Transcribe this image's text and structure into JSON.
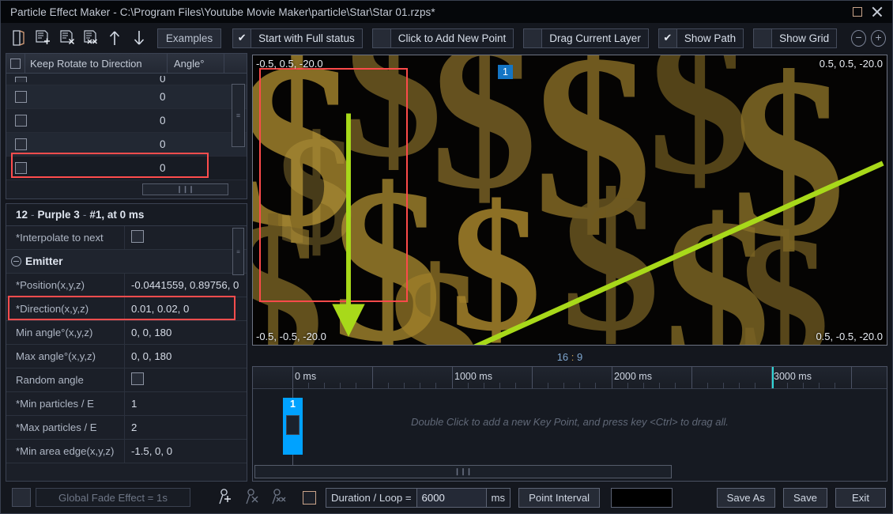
{
  "window": {
    "title": "Particle Effect Maker - C:\\Program Files\\Youtube Movie Maker\\particle\\Star\\Star 01.rzps*",
    "maximize_icon": "maximize-icon",
    "close_icon": "close-icon"
  },
  "toolbar": {
    "icons": [
      {
        "name": "open-file-icon"
      },
      {
        "name": "add-layer-icon"
      },
      {
        "name": "delete-layer-icon"
      },
      {
        "name": "delete-all-layers-icon"
      },
      {
        "name": "move-up-icon"
      },
      {
        "name": "move-down-icon"
      }
    ],
    "examples_label": "Examples",
    "checks": [
      {
        "name": "start-with-full-status",
        "label": "Start with Full status",
        "checked": true,
        "mark": "✔"
      },
      {
        "name": "click-to-add-new-point",
        "label": "Click to Add New Point",
        "checked": false,
        "mark": ""
      },
      {
        "name": "drag-current-layer",
        "label": "Drag Current Layer",
        "checked": false,
        "mark": ""
      },
      {
        "name": "show-path",
        "label": "Show Path",
        "checked": true,
        "mark": "✔"
      },
      {
        "name": "show-grid",
        "label": "Show Grid",
        "checked": false,
        "mark": ""
      }
    ],
    "zoom_out": "−",
    "zoom_in": "+"
  },
  "rotate_table": {
    "header": {
      "col_keep": "Keep Rotate to Direction",
      "col_angle": "Angle°"
    },
    "rows": [
      {
        "angle": "0",
        "checked": false
      },
      {
        "angle": "0",
        "checked": false
      },
      {
        "angle": "0",
        "checked": false
      },
      {
        "angle": "0",
        "checked": false
      },
      {
        "angle": "0",
        "checked": false
      }
    ],
    "scroll_grip": "≡",
    "hbar_grip": "❙❙❙"
  },
  "properties": {
    "title": {
      "number": "12",
      "dash1": "-",
      "name": "Purple 3",
      "dash2": "-",
      "rest": "#1, at 0 ms"
    },
    "rows": [
      {
        "type": "prop",
        "name": "interpolate-to-next",
        "label": "*Interpolate to next",
        "value": "",
        "control": "checkbox",
        "checked": false
      },
      {
        "type": "group",
        "name": "emitter-group",
        "label": "Emitter"
      },
      {
        "type": "prop",
        "name": "position-xyz",
        "label": "*Position(x,y,z)",
        "value": "-0.0441559, 0.89756, 0",
        "control": "text"
      },
      {
        "type": "prop",
        "name": "direction-xyz",
        "label": "*Direction(x,y,z)",
        "value": "0.01, 0.02, 0",
        "control": "text",
        "highlighted": true
      },
      {
        "type": "prop",
        "name": "min-angle-xyz",
        "label": "Min angle°(x,y,z)",
        "value": "0, 0, 180",
        "control": "text"
      },
      {
        "type": "prop",
        "name": "max-angle-xyz",
        "label": "Max angle°(x,y,z)",
        "value": "0, 0, 180",
        "control": "text"
      },
      {
        "type": "prop",
        "name": "random-angle",
        "label": "Random angle",
        "value": "",
        "control": "checkbox",
        "checked": false
      },
      {
        "type": "prop",
        "name": "min-particles-per-e",
        "label": "*Min particles / E",
        "value": "1",
        "control": "text"
      },
      {
        "type": "prop",
        "name": "max-particles-per-e",
        "label": "*Max particles / E",
        "value": "2",
        "control": "text"
      },
      {
        "type": "prop",
        "name": "min-area-edge-xyz",
        "label": "*Min area edge(x,y,z)",
        "value": "-1.5, 0, 0",
        "control": "text"
      }
    ],
    "scroll_grip": "≡"
  },
  "preview": {
    "corner_top_left": "-0.5, 0.5, -20.0",
    "corner_top_right": "0.5, 0.5, -20.0",
    "corner_bottom_left": "-0.5, -0.5, -20.0",
    "corner_bottom_right": "0.5, -0.5, -20.0",
    "layer_badge": "1",
    "aspect_left": "16",
    "aspect_colon": ":",
    "aspect_right": "9",
    "selection_color": "#fc4a4a",
    "path_arrow_color": "#a8d91a"
  },
  "timeline": {
    "labels": [
      "0 ms",
      "1000 ms",
      "2000 ms",
      "3000 ms"
    ],
    "hint": "Double Click to add a new Key Point, and press key <Ctrl> to drag all.",
    "keyframe_number": "1",
    "keyframe_color": "#00a2ff",
    "playhead_color": "#2fd6d6",
    "hbar_grip": "❙❙❙"
  },
  "bottom": {
    "global_fade_label": "Global Fade Effect = 1s",
    "fade_checked": false,
    "point_icons": [
      {
        "name": "add-point-icon"
      },
      {
        "name": "delete-point-icon"
      },
      {
        "name": "delete-all-points-icon"
      }
    ],
    "loop_checkbox": false,
    "duration_label": "Duration / Loop =",
    "duration_value": "6000",
    "duration_unit": "ms",
    "point_interval_label": "Point Interval",
    "color_swatch": "#000000",
    "save_as_label": "Save As",
    "save_label": "Save",
    "exit_label": "Exit"
  }
}
